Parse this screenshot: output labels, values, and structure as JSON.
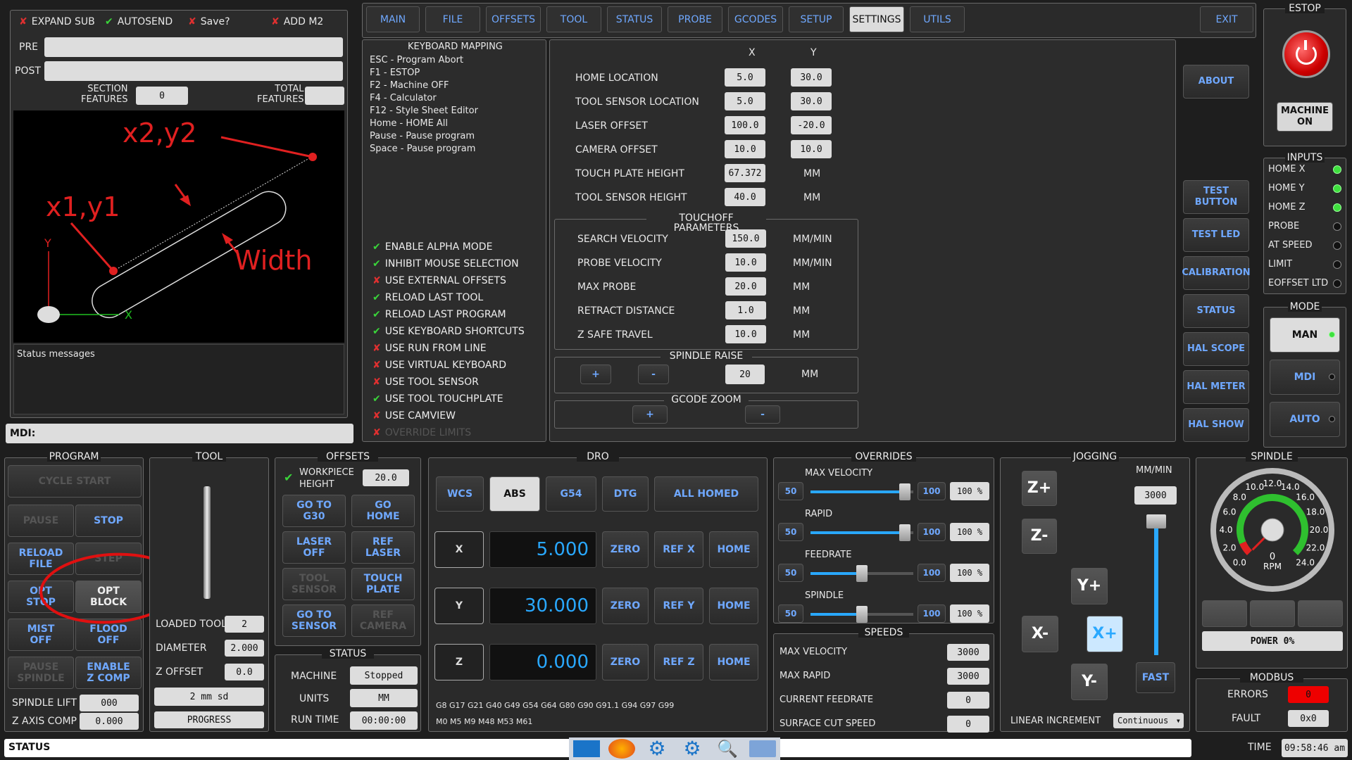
{
  "top_options": {
    "expand_sub": "EXPAND SUB",
    "autosend": "AUTOSEND",
    "save": "Save?",
    "add_m2": "ADD M2"
  },
  "pre_label": "PRE",
  "post_label": "POST",
  "section_features": "SECTION\nFEATURES",
  "section_features_value": "0",
  "total_features": "TOTAL\nFEATURES",
  "total_features_value": "",
  "diagram": {
    "p2": "x2,y2",
    "p1": "x1,y1",
    "width": "Width",
    "axis_y": "Y",
    "axis_x": "X"
  },
  "status_messages": "Status messages",
  "mdi_label": "MDI:",
  "tabs": [
    "MAIN",
    "FILE",
    "OFFSETS",
    "TOOL",
    "STATUS",
    "PROBE",
    "GCODES",
    "SETUP",
    "SETTINGS",
    "UTILS"
  ],
  "active_tab": "SETTINGS",
  "exit": "EXIT",
  "estop": {
    "title": "ESTOP",
    "machine_on": "MACHINE\nON"
  },
  "keyboard": {
    "title": "KEYBOARD MAPPING",
    "lines": [
      "ESC - Program Abort",
      "F1 - ESTOP",
      "F2 - Machine OFF",
      "F4 - Calculator",
      "F12 - Style Sheet Editor",
      "Home - HOME All",
      "Pause - Pause program",
      "Space - Pause program"
    ]
  },
  "checks": [
    {
      "label": "ENABLE ALPHA MODE",
      "on": true
    },
    {
      "label": "INHIBIT MOUSE SELECTION",
      "on": true
    },
    {
      "label": "USE EXTERNAL OFFSETS",
      "on": false
    },
    {
      "label": "RELOAD LAST TOOL",
      "on": true
    },
    {
      "label": "RELOAD LAST PROGRAM",
      "on": true
    },
    {
      "label": "USE KEYBOARD SHORTCUTS",
      "on": true
    },
    {
      "label": "USE RUN FROM LINE",
      "on": false
    },
    {
      "label": "USE VIRTUAL KEYBOARD",
      "on": false
    },
    {
      "label": "USE TOOL SENSOR",
      "on": false
    },
    {
      "label": "USE TOOL TOUCHPLATE",
      "on": true
    },
    {
      "label": "USE CAMVIEW",
      "on": false
    },
    {
      "label": "OVERRIDE LIMITS",
      "on": false
    }
  ],
  "settings": {
    "col_x": "X",
    "col_y": "Y",
    "rows": [
      {
        "label": "HOME LOCATION",
        "x": "5.0",
        "y": "30.0"
      },
      {
        "label": "TOOL SENSOR LOCATION",
        "x": "5.0",
        "y": "30.0"
      },
      {
        "label": "LASER OFFSET",
        "x": "100.0",
        "y": "-20.0"
      },
      {
        "label": "CAMERA OFFSET",
        "x": "10.0",
        "y": "10.0"
      },
      {
        "label": "TOUCH PLATE HEIGHT",
        "x": "67.372",
        "y": "MM"
      },
      {
        "label": "TOOL SENSOR HEIGHT",
        "x": "40.0",
        "y": "MM"
      }
    ],
    "touchoff_title": "TOUCHOFF PARAMETERS",
    "touchoff": [
      {
        "label": "SEARCH VELOCITY",
        "v": "150.0",
        "u": "MM/MIN"
      },
      {
        "label": "PROBE VELOCITY",
        "v": "10.0",
        "u": "MM/MIN"
      },
      {
        "label": "MAX PROBE",
        "v": "20.0",
        "u": "MM"
      },
      {
        "label": "RETRACT DISTANCE",
        "v": "1.0",
        "u": "MM"
      },
      {
        "label": "Z SAFE TRAVEL",
        "v": "10.0",
        "u": "MM"
      }
    ],
    "spindle_raise_title": "SPINDLE RAISE",
    "plus": "+",
    "minus": "-",
    "spindle_raise_value": "20",
    "spindle_raise_unit": "MM",
    "gcode_zoom_title": "GCODE ZOOM"
  },
  "side_buttons": [
    "ABOUT",
    "TEST BUTTON",
    "TEST LED",
    "CALIBRATION",
    "STATUS",
    "HAL SCOPE",
    "HAL METER",
    "HAL SHOW"
  ],
  "inputs": {
    "title": "INPUTS",
    "items": [
      {
        "label": "HOME X",
        "on": true
      },
      {
        "label": "HOME Y",
        "on": true
      },
      {
        "label": "HOME Z",
        "on": true
      },
      {
        "label": "PROBE",
        "on": false
      },
      {
        "label": "AT SPEED",
        "on": false
      },
      {
        "label": "LIMIT",
        "on": false
      },
      {
        "label": "EOFFSET LTD",
        "on": false
      }
    ]
  },
  "mode": {
    "title": "MODE",
    "items": [
      "MAN",
      "MDI",
      "AUTO"
    ]
  },
  "program": {
    "title": "PROGRAM",
    "cycle_start": "CYCLE START",
    "pause": "PAUSE",
    "stop": "STOP",
    "reload": "RELOAD\nFILE",
    "step": "STEP",
    "opt_stop": "OPT\nSTOP",
    "opt_block": "OPT\nBLOCK",
    "mist": "MIST\nOFF",
    "flood": "FLOOD\nOFF",
    "pause_spindle": "PAUSE\nSPINDLE",
    "enable_zcomp": "ENABLE\nZ COMP",
    "spindle_lift": "SPINDLE LIFT",
    "spindle_lift_value": "000",
    "z_axis_comp": "Z AXIS COMP",
    "z_axis_comp_value": "0.000"
  },
  "tool": {
    "title": "TOOL",
    "loaded": "LOADED TOOL",
    "loaded_value": "2",
    "diameter": "DIAMETER",
    "diameter_value": "2.000",
    "z_offset": "Z OFFSET",
    "z_offset_value": "0.0",
    "tool_desc": "2 mm sd",
    "progress": "PROGRESS"
  },
  "offsets": {
    "title": "OFFSETS",
    "wp_height": "WORKPIECE\nHEIGHT",
    "wp_value": "20.0",
    "goto_g30": "GO TO\nG30",
    "go_home": "GO\nHOME",
    "laser_off": "LASER\nOFF",
    "ref_laser": "REF\nLASER",
    "tool_sensor": "TOOL\nSENSOR",
    "touch_plate": "TOUCH\nPLATE",
    "goto_sensor": "GO TO\nSENSOR",
    "ref_camera": "REF\nCAMERA"
  },
  "status_box": {
    "title": "STATUS",
    "machine": "MACHINE",
    "machine_v": "Stopped",
    "units": "UNITS",
    "units_v": "MM",
    "run_time": "RUN TIME",
    "run_time_v": "00:00:00"
  },
  "dro": {
    "title": "DRO",
    "wcs": "WCS",
    "abs": "ABS",
    "g54": "G54",
    "dtg": "DTG",
    "all_homed": "ALL HOMED",
    "axes": [
      {
        "axis": "X",
        "value": "5.000",
        "ref": "REF X"
      },
      {
        "axis": "Y",
        "value": "30.000",
        "ref": "REF Y"
      },
      {
        "axis": "Z",
        "value": "0.000",
        "ref": "REF Z"
      }
    ],
    "zero": "ZERO",
    "home": "HOME",
    "gcodes": "G8 G17 G21 G40 G49 G54 G64 G80 G90 G91.1 G94 G97 G99",
    "mcodes": "M0 M5 M9 M48 M53 M61"
  },
  "overrides": {
    "title": "OVERRIDES",
    "items": [
      {
        "label": "MAX VELOCITY",
        "min": "50",
        "max": "100",
        "pct": "100 %",
        "level": 0.92
      },
      {
        "label": "RAPID",
        "min": "50",
        "max": "100",
        "pct": "100 %",
        "level": 0.92
      },
      {
        "label": "FEEDRATE",
        "min": "50",
        "max": "100",
        "pct": "100 %",
        "level": 0.5
      },
      {
        "label": "SPINDLE",
        "min": "50",
        "max": "100",
        "pct": "100 %",
        "level": 0.5
      }
    ]
  },
  "speeds": {
    "title": "SPEEDS",
    "items": [
      {
        "label": "MAX VELOCITY",
        "v": "3000"
      },
      {
        "label": "MAX RAPID",
        "v": "3000"
      },
      {
        "label": "CURRENT FEEDRATE",
        "v": "0"
      },
      {
        "label": "SURFACE CUT SPEED",
        "v": "0"
      }
    ]
  },
  "jogging": {
    "title": "JOGGING",
    "units": "MM/MIN",
    "rate": "3000",
    "fast": "FAST",
    "linear": "LINEAR INCREMENT",
    "increment": "Continuous",
    "zp": "Z+",
    "zm": "Z-",
    "yp": "Y+",
    "ym": "Y-",
    "xp": "X+",
    "xm": "X-"
  },
  "spindle": {
    "title": "SPINDLE",
    "ticks": [
      "0.0",
      "2.0",
      "4.0",
      "6.0",
      "8.0",
      "10.0",
      "12.0",
      "14.0",
      "16.0",
      "18.0",
      "20.0",
      "22.0",
      "24.0"
    ],
    "value": "0",
    "unit": "RPM",
    "power": "POWER 0%"
  },
  "modbus": {
    "title": "MODBUS",
    "errors": "ERRORS",
    "errors_v": "0",
    "fault": "FAULT",
    "fault_v": "0x0"
  },
  "status_bar": "STATUS",
  "time_label": "TIME",
  "time": "09:58:46 am"
}
